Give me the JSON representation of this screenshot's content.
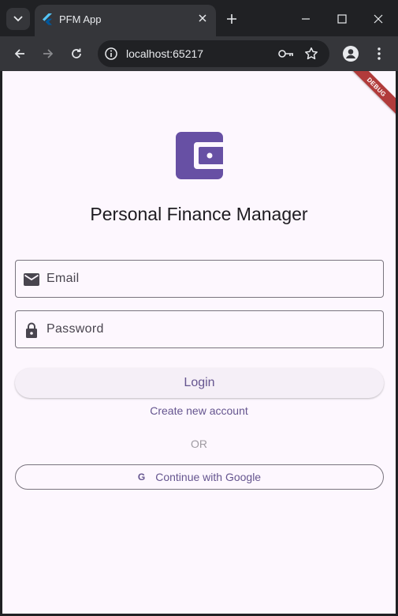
{
  "browser": {
    "tab_title": "PFM App",
    "url": "localhost:65217"
  },
  "banner": {
    "label": "DEBUG"
  },
  "app": {
    "title": "Personal Finance Manager",
    "email_label": "Email",
    "password_label": "Password",
    "login_label": "Login",
    "create_account_label": "Create new account",
    "or_label": "OR",
    "google_icon": "G",
    "google_label": "Continue with Google"
  },
  "colors": {
    "primary": "#65558f",
    "logo": "#6750a4",
    "background": "#fdf7fe",
    "debug_banner": "#b13b3b"
  },
  "icons": {
    "tab_search": "chevron-down-icon",
    "favicon": "flutter-icon",
    "email": "mail-icon",
    "password": "lock-icon",
    "logo": "wallet-icon"
  }
}
